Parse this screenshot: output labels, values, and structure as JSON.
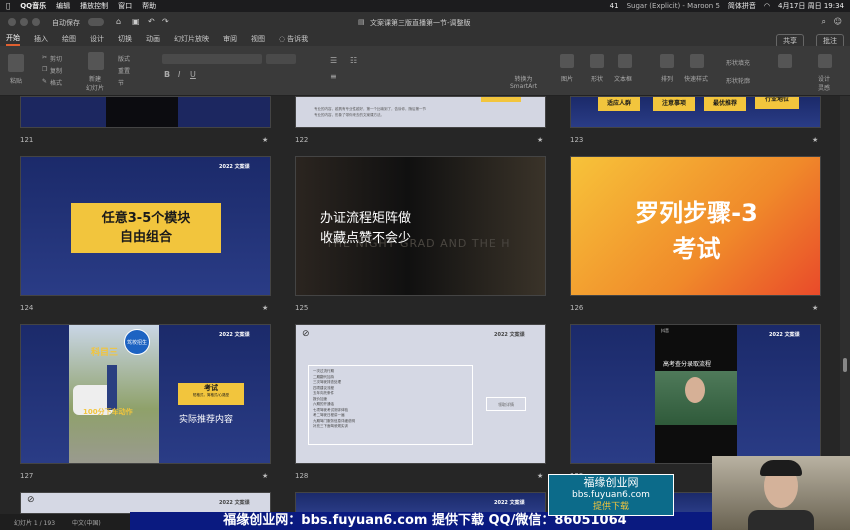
{
  "menubar": {
    "app": "QQ音乐",
    "items": [
      "编辑",
      "播放控制",
      "窗口",
      "帮助"
    ],
    "badge": "41",
    "song": "Sugar (Explicit) - Maroon 5",
    "ime": "简体拼音",
    "clock": "4月17日 周日 19:34"
  },
  "titlebar": {
    "autosave": "自动保存",
    "doc_title": "文案课第三版直播第一节-调整版"
  },
  "tabs": [
    "开始",
    "插入",
    "绘图",
    "设计",
    "切换",
    "动画",
    "幻灯片放映",
    "审阅",
    "视图",
    "告诉我"
  ],
  "tab_right": {
    "share": "共享",
    "comment": "批注"
  },
  "ribbon": {
    "paste": "粘贴",
    "cut": "剪切",
    "copy": "复制",
    "format": "格式",
    "new_slide": "新建\n幻灯片",
    "layout": "版式",
    "reset": "重置",
    "section": "节",
    "smartart": "转换为\nSmartArt",
    "picture": "图片",
    "shapes": "形状",
    "textbox": "文本框",
    "arrange": "排列",
    "quick_styles": "快速样式",
    "shape_fill": "形状填充",
    "shape_outline": "形状轮廓",
    "design_ideas": "设计\n灵感"
  },
  "slides": [
    {
      "num": "121"
    },
    {
      "num": "122",
      "text1": "专业的内容，越具有专业性越好，第一个比喻到了，告诉你，随后第一节",
      "text2": "专业的内容，形象了带你来去的文案课方法。"
    },
    {
      "num": "123",
      "tags": [
        "适应人群",
        "注意事项",
        "最优推荐",
        "行业地位"
      ]
    },
    {
      "num": "124",
      "year": "2022  文案课",
      "box1": "任意3-5个模块",
      "box2": "自由组合"
    },
    {
      "num": "125",
      "line1": "办证流程矩阵做",
      "line2": "收藏点赞不会少",
      "bg": "THE NIGHT GRAD AND THE H"
    },
    {
      "num": "126",
      "title": "罗列步骤-3",
      "sub": "考试"
    },
    {
      "num": "127",
      "year": "2022  文案课",
      "sign": "驾校招生",
      "subject": "科目三",
      "box": "考试",
      "boxsub": "短格式，简格式/心路型",
      "caption": "实际推荐内容",
      "photo_caption": "100分下车动作"
    },
    {
      "num": "128",
      "year": "2022  文案课",
      "list": [
        "一次过流行期",
        "二期翻代加持",
        "三次驾驶排查处理",
        "四项建议流程",
        "五年向托条件",
        "报价加速",
        "六期的开通话",
        "七项驾驶考试测评体验",
        "考二驾驶日程讲一遍",
        "九期驾门服务信息详细说明",
        "补充三下面驾驶规实训"
      ],
      "button": "领取详情"
    },
    {
      "num": "129",
      "year": "2022  文案课",
      "caption": "高考查分录取流程",
      "app": "抖音"
    }
  ],
  "row4": [
    {
      "year": "2022  文案课"
    },
    {
      "year": "2022  文案课"
    }
  ],
  "watermark": {
    "line1": "福缘创业网",
    "line2": "bbs.fuyuan6.com",
    "line3": "提供下载"
  },
  "status": {
    "slide": "幻灯片 1 / 193",
    "lang": "中文(中国)"
  },
  "banner": "福缘创业网：bbs.fuyuan6.com   提供下载    QQ/微信：86051064"
}
